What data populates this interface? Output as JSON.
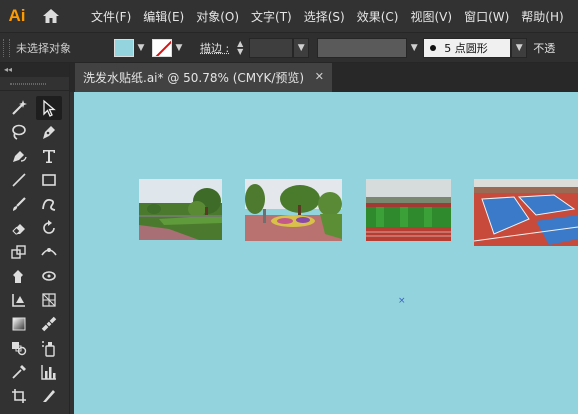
{
  "app": {
    "logo_text": "Ai",
    "accent_color": "#ff9a00"
  },
  "menu": {
    "items": [
      "文件(F)",
      "编辑(E)",
      "对象(O)",
      "文字(T)",
      "选择(S)",
      "效果(C)",
      "视图(V)",
      "窗口(W)",
      "帮助(H)"
    ]
  },
  "control": {
    "selection_label": "未选择对象",
    "fill_color": "#94d4de",
    "stroke_label": "描边 :",
    "brush_label": "5 点圆形",
    "opacity_label": "不透"
  },
  "tools_panel": {
    "collapse_label": "◂◂"
  },
  "document": {
    "tab_title": "洗发水贴纸.ai* @ 50.78% (CMYK/预览)",
    "close_glyph": "✕",
    "canvas_color": "#93d3dd"
  },
  "canvas": {
    "center_marker": "×",
    "photos": [
      {
        "name": "garden-path-photo"
      },
      {
        "name": "flower-roundabout-photo"
      },
      {
        "name": "stadium-field-photo"
      },
      {
        "name": "rubber-court-photo"
      }
    ]
  }
}
